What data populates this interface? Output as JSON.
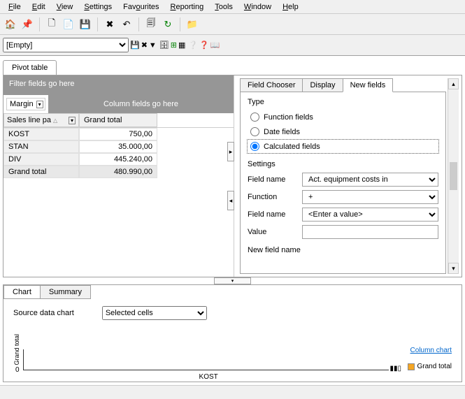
{
  "menu": {
    "file": "File",
    "edit": "Edit",
    "view": "View",
    "settings": "Settings",
    "favourites": "Favourites",
    "reporting": "Reporting",
    "tools": "Tools",
    "window": "Window",
    "help": "Help"
  },
  "filter_combo": "[Empty]",
  "main_tab": "Pivot table",
  "pivot": {
    "filter_placeholder": "Filter fields go here",
    "col_placeholder": "Column fields go here",
    "data_field": "Margin",
    "row_field": "Sales line pa",
    "grand_total_col": "Grand total",
    "rows": [
      {
        "label": "KOST",
        "value": "750,00"
      },
      {
        "label": "STAN",
        "value": "35.000,00"
      },
      {
        "label": "DIV",
        "value": "445.240,00"
      }
    ],
    "grand_total_row": {
      "label": "Grand total",
      "value": "480.990,00"
    }
  },
  "right_tabs": {
    "t1": "Field Chooser",
    "t2": "Display",
    "t3": "New fields"
  },
  "new_fields": {
    "type_label": "Type",
    "opt1": "Function fields",
    "opt2": "Date fields",
    "opt3": "Calculated fields",
    "settings_label": "Settings",
    "field_name_label": "Field name",
    "function_label": "Function",
    "value_label": "Value",
    "new_field_label": "New field name",
    "field_name_1": "Act. equipment costs in",
    "function": "+",
    "field_name_2": "<Enter a value>"
  },
  "chart": {
    "tab1": "Chart",
    "tab2": "Summary",
    "source_label": "Source data chart",
    "source_value": "Selected cells",
    "y_axis": "Grand total",
    "x_category": "KOST",
    "tick": "0",
    "link": "Column chart",
    "legend": "Grand total"
  },
  "chart_data": {
    "type": "bar",
    "categories": [
      "KOST"
    ],
    "values": [
      0
    ],
    "title": "",
    "xlabel": "KOST",
    "ylabel": "Grand total",
    "series": [
      {
        "name": "Grand total",
        "values": [
          0
        ]
      }
    ]
  }
}
